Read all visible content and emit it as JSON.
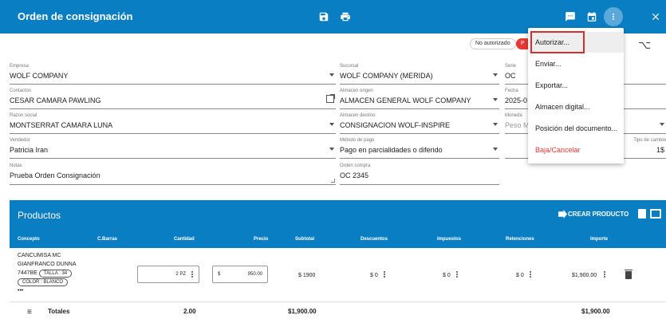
{
  "header": {
    "title": "Orden de consignación"
  },
  "status": {
    "unauthorized": "No autorizado",
    "red_chip": "P"
  },
  "form": {
    "empresa": {
      "label": "Empresa",
      "value": "WOLF COMPANY"
    },
    "contactos": {
      "label": "Contactos",
      "value": "CESAR CAMARA PAWLING"
    },
    "razon_social": {
      "label": "Razon social",
      "value": "MONTSERRAT CAMARA LUNA"
    },
    "vendedor": {
      "label": "Vendedor",
      "value": "Patricia Iran"
    },
    "notas": {
      "label": "Notas",
      "value": "Prueba Orden Consignación"
    },
    "sucursal": {
      "label": "Sucursal",
      "value": "WOLF COMPANY (MERIDA)"
    },
    "almacen_origen": {
      "label": "Almacen origen",
      "value": "ALMACEN GENERAL WOLF COMPANY"
    },
    "almacen_destino": {
      "label": "Almacen destino",
      "value": "CONSIGNACION WOLF-INSPIRE"
    },
    "metodo_pago": {
      "label": "Método de pago",
      "value": "Pago en parcialidades o diferido"
    },
    "orden_compra": {
      "label": "Orden compra",
      "value": "OC 2345"
    },
    "serie": {
      "label": "Serie",
      "value": "OC"
    },
    "fecha": {
      "label": "Fecha",
      "value": "2025-0"
    },
    "moneda": {
      "label": "Moneda",
      "value": "Peso M"
    },
    "tipo_cambio": {
      "label": "Tipo de cambio",
      "value": "1$"
    }
  },
  "menu": {
    "items": [
      "Autorizar...",
      "Enviar...",
      "Exportar...",
      "Almacen digital...",
      "Posición del documento...",
      "Baja/Cancelar"
    ]
  },
  "products": {
    "title": "Productos",
    "create_label": "CREAR PRODUCTO",
    "columns": [
      "Concepto",
      "C.Barras",
      "Cantidad",
      "Precio",
      "Subtotal",
      "Descuentos",
      "Impuestos",
      "Retenciones",
      "Importe"
    ],
    "row": {
      "concept_line1": "CANCUMISA MC",
      "concept_line2": "GIANFRANCO DUNNA",
      "concept_code": "7447BE",
      "tag_talla": "TALLA : 34",
      "tag_color": "COLOR : BLANCO",
      "more": "•••",
      "quantity": "2 PZ",
      "price_symbol": "$",
      "price": "950.00",
      "subtotal": "$ 1900",
      "descuentos": "$ 0",
      "impuestos": "$ 0",
      "retenciones": "$ 0",
      "importe": "$1,900.00"
    },
    "totals": {
      "label": "Totales",
      "cantidad": "2.00",
      "subtotal": "$1,900.00",
      "importe": "$1,900.00"
    }
  }
}
